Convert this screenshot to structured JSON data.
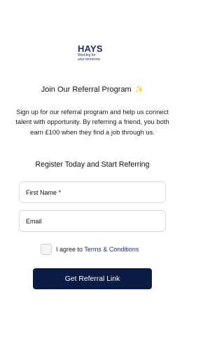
{
  "brand": {
    "name": "HAYS",
    "tagline_line1": "Working for",
    "tagline_line2": "your tomorrow",
    "color": "#1a2f6e"
  },
  "header": {
    "headline": "Join Our Referral Program",
    "headline_icon": "party-popper-icon"
  },
  "intro": {
    "text": "Sign up for our referral program and help us connect talent with opportunity. By referring a friend, you both earn £100 when they find a job through us."
  },
  "form": {
    "heading": "Register Today and Start Referring",
    "first_name_placeholder": "First Name *",
    "email_placeholder": "Email",
    "terms_prefix": "I agree to ",
    "terms_link": "Terms & Conditions",
    "terms_checked": false,
    "submit_label": "Get Referral Link",
    "submit_color": "#0c1b44"
  }
}
